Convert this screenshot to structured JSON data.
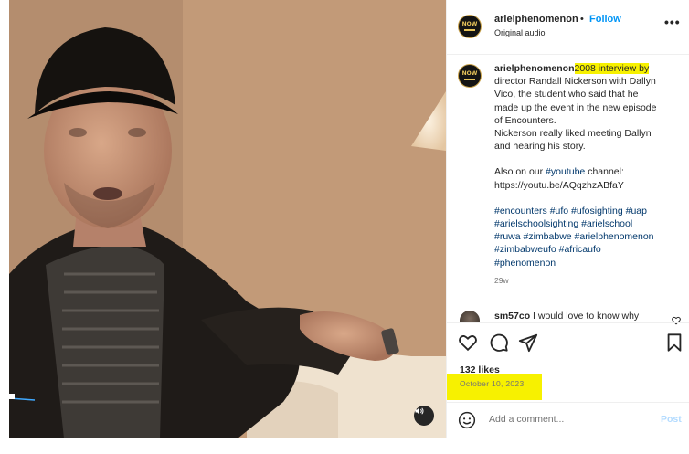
{
  "post": {
    "username": "arielphenomenon",
    "dot": "•",
    "follow_label": "Follow",
    "audio": "Original audio",
    "more_label": "•••",
    "avatar_text": "NOW"
  },
  "caption": {
    "username": "arielphenomenon",
    "highlighted": "2008 interview by",
    "line1": "director Randall Nickerson with Dallyn",
    "line2": "Vico, the student who said that he",
    "line3": "made up the event in the new episode",
    "line4": "of Encounters.",
    "line5": "Nickerson really liked meeting Dallyn",
    "line6": "and hearing his story.",
    "also_text": "Also on our",
    "youtube_tag": "#youtube",
    "channel_text": "channel:",
    "youtube_link": "https://youtu.be/AQqzhzABfaY",
    "hashtag_line1": "#encounters #ufo #ufosighting #uap",
    "hashtag_line2": "#arielschoolsighting #arielschool",
    "hashtag_line3": "#ruwa #zimbabwe #arielphenomenon",
    "hashtag_line4": "#zimbabweufo #africaufo",
    "hashtag_line5": "#phenomenon",
    "time": "29w"
  },
  "comment": {
    "username": "sm57co",
    "text": "I would love to know why"
  },
  "stats": {
    "likes": "132 likes",
    "date": "October 10, 2023"
  },
  "add_comment": {
    "placeholder": "Add a comment...",
    "post_label": "Post"
  },
  "colors": {
    "accent": "#0095f6",
    "highlight": "#f7f100",
    "link": "#00376b",
    "muted": "#737373"
  },
  "icons": [
    "mute-icon",
    "more-options-icon",
    "heart-icon",
    "comment-icon",
    "share-icon",
    "bookmark-icon",
    "emoji-icon",
    "like-comment-icon"
  ]
}
